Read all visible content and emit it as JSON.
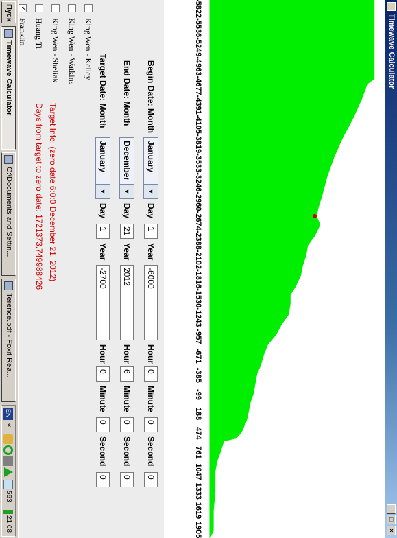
{
  "window": {
    "title": "Timewave Calculator"
  },
  "chart_data": {
    "type": "area",
    "title": "",
    "xlabel": "",
    "ylabel": "",
    "x_ticks": [
      "-5822",
      "-5536",
      "-5249",
      "-4963",
      "-4677",
      "-4391",
      "-4105",
      "-3819",
      "-3533",
      "-3246",
      "-2960",
      "-2674",
      "-2388",
      "-2102",
      "-1816",
      "-1530",
      "-1243",
      "-957",
      "-671",
      "-385",
      "-99",
      "188",
      "474",
      "761",
      "1047",
      "1333",
      "1619",
      "1905"
    ],
    "xlim": [
      -5822,
      2012
    ],
    "ylim": [
      0,
      1
    ],
    "series": [
      {
        "x": [
          -5822,
          -5536,
          -5249,
          -4963,
          -4677,
          -4600,
          -4391,
          -4105,
          -3819,
          -3533,
          -3246,
          -2960,
          -2800,
          -2674,
          -2550,
          -2388,
          -2250,
          -2102,
          -1950,
          -1816,
          -1650,
          -1530,
          -1400,
          -1243,
          -1100,
          -957,
          -800,
          -671,
          -500,
          -385,
          -250,
          -99,
          50,
          188,
          300,
          474,
          560,
          600,
          761,
          900,
          1047,
          1333,
          1619,
          1905,
          2012
        ],
        "y": [
          0.94,
          0.94,
          0.94,
          0.94,
          0.94,
          0.9,
          0.87,
          0.82,
          0.76,
          0.71,
          0.67,
          0.64,
          0.62,
          0.61,
          0.63,
          0.6,
          0.56,
          0.55,
          0.53,
          0.52,
          0.49,
          0.46,
          0.46,
          0.45,
          0.41,
          0.38,
          0.33,
          0.31,
          0.29,
          0.27,
          0.26,
          0.25,
          0.23,
          0.22,
          0.21,
          0.18,
          0.15,
          0.08,
          0.06,
          0.04,
          0.03,
          0.03,
          0.02,
          0.02,
          0.0
        ]
      }
    ],
    "marker": {
      "x": -2674,
      "y": 0.6,
      "color": "#cc0000"
    },
    "fill_color": "#00ee00",
    "grid": false,
    "legend": "none"
  },
  "form": {
    "begin": {
      "label": "Begin Date: Month",
      "month": "January",
      "day_label": "Day",
      "day": "1",
      "year_label": "Year",
      "year": "-6000",
      "hour_label": "Hour",
      "hour": "0",
      "minute_label": "Minute",
      "minute": "0",
      "second_label": "Second",
      "second": "0"
    },
    "end": {
      "label": "End Date: Month",
      "month": "December",
      "day_label": "Day",
      "day": "21",
      "year_label": "Year",
      "year": "2012",
      "hour_label": "Hour",
      "hour": "6",
      "minute_label": "Minute",
      "minute": "0",
      "second_label": "Second",
      "second": "0"
    },
    "target": {
      "label": "Target Date: Month",
      "month": "January",
      "day_label": "Day",
      "day": "1",
      "year_label": "Year",
      "year": "-2700",
      "hour_label": "Hour",
      "hour": "0",
      "minute_label": "Minute",
      "minute": "0",
      "second_label": "Second",
      "second": "0"
    },
    "info_line1": "Target Info: (zero date 6:0:0 December 21, 2012)",
    "info_line2": "Days from target to zero date: 1721373.749988426"
  },
  "checkboxes": [
    {
      "label": "King Wen - Kelley",
      "checked": false
    },
    {
      "label": "King Wen - Watkins",
      "checked": false
    },
    {
      "label": "King Wen - Sheliak",
      "checked": false
    },
    {
      "label": "Huang Ti",
      "checked": false
    },
    {
      "label": "Franklin",
      "checked": true
    }
  ],
  "taskbar": {
    "start_label": "Пуск",
    "tasks": [
      {
        "label": "Timewave Calculator",
        "active": true
      },
      {
        "label": "C:\\Documents and Settin...",
        "active": false
      },
      {
        "label": "Terence.pdf - Foxit Rea...",
        "active": false
      }
    ],
    "lang": "EN",
    "tray_counter": "563",
    "clock": "21:08"
  }
}
